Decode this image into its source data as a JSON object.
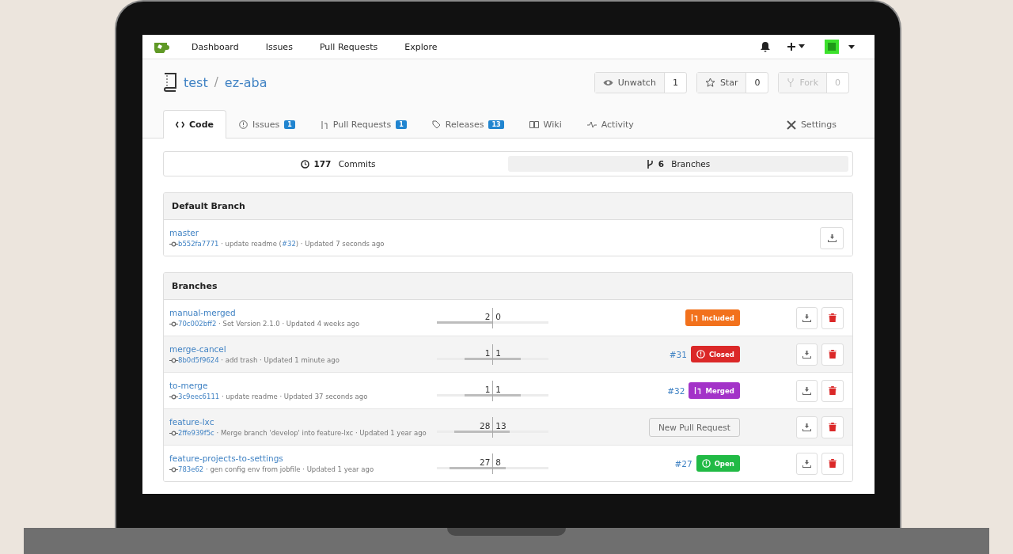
{
  "nav": {
    "items": [
      "Dashboard",
      "Issues",
      "Pull Requests",
      "Explore"
    ]
  },
  "repo": {
    "owner": "test",
    "separator": "/",
    "name": "ez-aba",
    "actions": [
      {
        "label": "Unwatch",
        "count": "1",
        "kind": "watch",
        "disabled": false
      },
      {
        "label": "Star",
        "count": "0",
        "kind": "star",
        "disabled": false
      },
      {
        "label": "Fork",
        "count": "0",
        "kind": "fork",
        "disabled": true
      }
    ]
  },
  "tabs": [
    {
      "label": "Code",
      "kind": "code",
      "selected": true
    },
    {
      "label": "Issues",
      "kind": "issues",
      "count": "1",
      "selected": false
    },
    {
      "label": "Pull Requests",
      "kind": "pulls",
      "count": "1",
      "selected": false
    },
    {
      "label": "Releases",
      "kind": "releases",
      "count": "13",
      "selected": false
    },
    {
      "label": "Wiki",
      "kind": "wiki",
      "selected": false
    },
    {
      "label": "Activity",
      "kind": "activity",
      "selected": false
    }
  ],
  "settings_tab": {
    "label": "Settings",
    "selected": false
  },
  "stats": [
    {
      "count": "177",
      "label": "Commits",
      "kind": "commits",
      "selected": false
    },
    {
      "count": "6",
      "label": "Branches",
      "kind": "branches",
      "selected": true
    }
  ],
  "default_branch": {
    "title": "Default Branch",
    "name": "master",
    "sha": "b552fa7771",
    "message": "· update readme (",
    "pr_link": "#32",
    "message_end": ") · Updated 7 seconds ago"
  },
  "branches": {
    "title": "Branches",
    "rows": [
      {
        "name": "manual-merged",
        "sha": "70c002bff2",
        "details": "· Set Version 2.1.0 · Updated 4 weeks ago",
        "behind": "2",
        "ahead": "0",
        "behind_bar": {
          "level": 1.0
        },
        "status": {
          "kind": "included",
          "label": "Included"
        }
      },
      {
        "name": "merge-cancel",
        "sha": "8b0d5f9624",
        "details": "· add trash · Updated 1 minute ago",
        "behind": "1",
        "ahead": "1",
        "behind_bar": {
          "level": 0.5
        },
        "ahead_bar": {
          "level": 0.5
        },
        "pr": "#31",
        "status": {
          "kind": "closed",
          "label": "Closed"
        }
      },
      {
        "name": "to-merge",
        "sha": "3c9eec6111",
        "details": "· update readme · Updated 37 seconds ago",
        "behind": "1",
        "ahead": "1",
        "behind_bar": {
          "level": 0.5
        },
        "ahead_bar": {
          "level": 0.5
        },
        "pr": "#32",
        "status": {
          "kind": "merged",
          "label": "Merged"
        }
      },
      {
        "name": "feature-lxc",
        "sha": "2ffe939f5c",
        "details": "· Merge branch 'develop' into feature-lxc · Updated 1 year ago",
        "behind": "28",
        "ahead": "13",
        "behind_bar": {
          "level": 0.69
        },
        "ahead_bar": {
          "level": 0.3
        },
        "status": {
          "kind": "new",
          "label": "New Pull Request"
        }
      },
      {
        "name": "feature-projects-to-settings",
        "sha": "783e62",
        "details": "· gen config env from jobfile · Updated 1 year ago",
        "behind": "27",
        "ahead": "8",
        "behind_bar": {
          "level": 0.77
        },
        "ahead_bar": {
          "level": 0.23
        },
        "pr": "#27",
        "status": {
          "kind": "open",
          "label": "Open"
        }
      }
    ]
  }
}
